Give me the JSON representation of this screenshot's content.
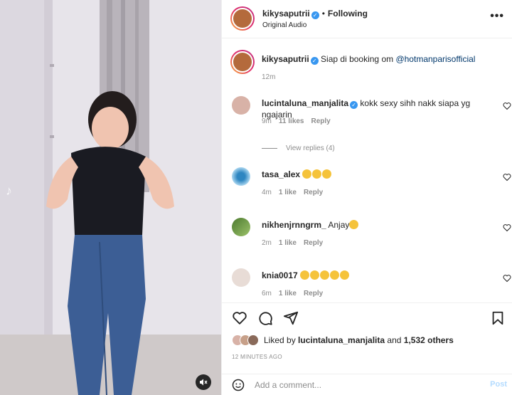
{
  "header": {
    "username": "kikysaputrii",
    "dot": "•",
    "following": "Following",
    "audio": "Original Audio",
    "more": "•••"
  },
  "caption": {
    "username": "kikysaputrii",
    "text": "Siap di booking om ",
    "mention": "@hotmanparisofficial",
    "time": "12m"
  },
  "comments": [
    {
      "username": "lucintaluna_manjalita",
      "verified": true,
      "text": "kokk sexy sihh nakk siapa yg ngajarin",
      "time": "9m",
      "likes": "11 likes",
      "reply": "Reply",
      "emoji_count": 0
    },
    {
      "username": "tasa_alex",
      "verified": false,
      "text": "",
      "time": "4m",
      "likes": "1 like",
      "reply": "Reply",
      "emoji_count": 3
    },
    {
      "username": "nikhenjrnngrm_",
      "verified": false,
      "text": "Anjay",
      "time": "2m",
      "likes": "1 like",
      "reply": "Reply",
      "emoji_count": 1
    },
    {
      "username": "knia0017",
      "verified": false,
      "text": "",
      "time": "6m",
      "likes": "1 like",
      "reply": "Reply",
      "emoji_count": 5
    }
  ],
  "view_replies": "View replies (4)",
  "likes": {
    "prefix": "Liked by ",
    "user": "lucintaluna_manjalita",
    "middle": " and ",
    "others": "1,532 others"
  },
  "timeago": "12 MINUTES AGO",
  "add_comment": {
    "placeholder": "Add a comment...",
    "post": "Post"
  },
  "colors": {
    "verified": "#3897f0",
    "mention": "#00376b",
    "post_disabled": "#b3dbff"
  }
}
